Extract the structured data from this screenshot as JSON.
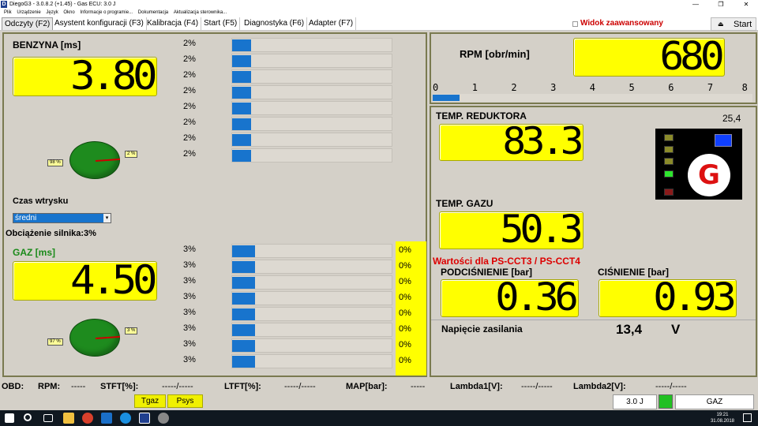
{
  "titlebar": {
    "title": "DiegoG3 - 3.0.8.2 (+1.45) - Gas ECU: 3.0 J",
    "app_icon": "D",
    "minimize": "—",
    "maximize": "❐",
    "close": "✕"
  },
  "menu": [
    "Plik",
    "Urządzenie",
    "Język",
    "Okno",
    "Informacje o programie...",
    "Dokumentacja",
    "Aktualizacja sterownika..."
  ],
  "tabs": [
    "Odczyty (F2)",
    "Asystent konfiguracji (F3)",
    "Kalibracja (F4)",
    "Start (F5)",
    "Diagnostyka (F6)",
    "Adapter (F7)"
  ],
  "advanced_view": {
    "label": "Widok zaawansowany",
    "checked": false
  },
  "start_button": {
    "label": "Start",
    "icon": "eject-icon",
    "glyph": "⏏"
  },
  "benzyna": {
    "label": "BENZYNA [ms]",
    "value": "3.80",
    "bars": [
      {
        "pct": "2%",
        "fill": 0.12
      },
      {
        "pct": "2%",
        "fill": 0.12
      },
      {
        "pct": "2%",
        "fill": 0.12
      },
      {
        "pct": "2%",
        "fill": 0.12
      },
      {
        "pct": "2%",
        "fill": 0.12
      },
      {
        "pct": "2%",
        "fill": 0.12
      },
      {
        "pct": "2%",
        "fill": 0.12
      },
      {
        "pct": "2%",
        "fill": 0.12
      }
    ],
    "pie": {
      "left": "98 %",
      "right": "2 %"
    }
  },
  "injection_time": {
    "label": "Czas wtrysku",
    "selected": "średni"
  },
  "engine_load": {
    "label": "Obciążenie silnika:3%"
  },
  "gaz": {
    "label": "GAZ [ms]",
    "value": "4.50",
    "bars": [
      {
        "pct": "3%",
        "fill": 0.14
      },
      {
        "pct": "3%",
        "fill": 0.14
      },
      {
        "pct": "3%",
        "fill": 0.14
      },
      {
        "pct": "3%",
        "fill": 0.14
      },
      {
        "pct": "3%",
        "fill": 0.14
      },
      {
        "pct": "3%",
        "fill": 0.14
      },
      {
        "pct": "3%",
        "fill": 0.14
      },
      {
        "pct": "3%",
        "fill": 0.14
      }
    ],
    "zeros": [
      "0%",
      "0%",
      "0%",
      "0%",
      "0%",
      "0%",
      "0%",
      "0%"
    ],
    "pie": {
      "left": "97 %",
      "right": "3 %"
    }
  },
  "rpm": {
    "label": "RPM [obr/min]",
    "value": "680",
    "scale": [
      "0",
      "1",
      "2",
      "3",
      "4",
      "5",
      "6",
      "7",
      "8"
    ],
    "fill": 0.085
  },
  "temp_reduktora": {
    "label": "TEMP. REDUKTORA",
    "value": "83.3",
    "aux": "25,4"
  },
  "temp_gazu": {
    "label": "TEMP. GAZU",
    "value": "50.3"
  },
  "sensor_title": "Wartości dla  PS-CCT3 / PS-CCT4",
  "podcisnienie": {
    "label": "PODCIŚNIENIE [bar]",
    "value": "0.36"
  },
  "cisnienie": {
    "label": "CIŚNIENIE [bar]",
    "value": "0.93"
  },
  "voltage": {
    "label": "Napięcie zasilania",
    "value": "13,4",
    "unit": "V"
  },
  "g_indicator": {
    "letter": "G",
    "leds": [
      "#8a8a2a",
      "#8a8a2a",
      "#8a8a2a",
      "#2ee62e",
      "#8a1a1a"
    ],
    "blue": "#1040ff"
  },
  "obd": {
    "obd": "OBD:",
    "rpm_label": "RPM:",
    "rpm": "-----",
    "stft_label": "STFT[%]:",
    "stft": "-----/-----",
    "ltft_label": "LTFT[%]:",
    "ltft": "-----/-----",
    "map_label": "MAP[bar]:",
    "map": "-----",
    "lambda1_label": "Lambda1[V]:",
    "lambda1": "-----/-----",
    "lambda2_label": "Lambda2[V]:",
    "lambda2": "-----/-----"
  },
  "bottom_buttons": [
    "Tgaz",
    "Psys"
  ],
  "status": {
    "version": "3.0 J",
    "mode": "GAZ",
    "led_color": "#22c022"
  },
  "taskbar": {
    "time": "19:21",
    "date": "31.08.2018"
  }
}
